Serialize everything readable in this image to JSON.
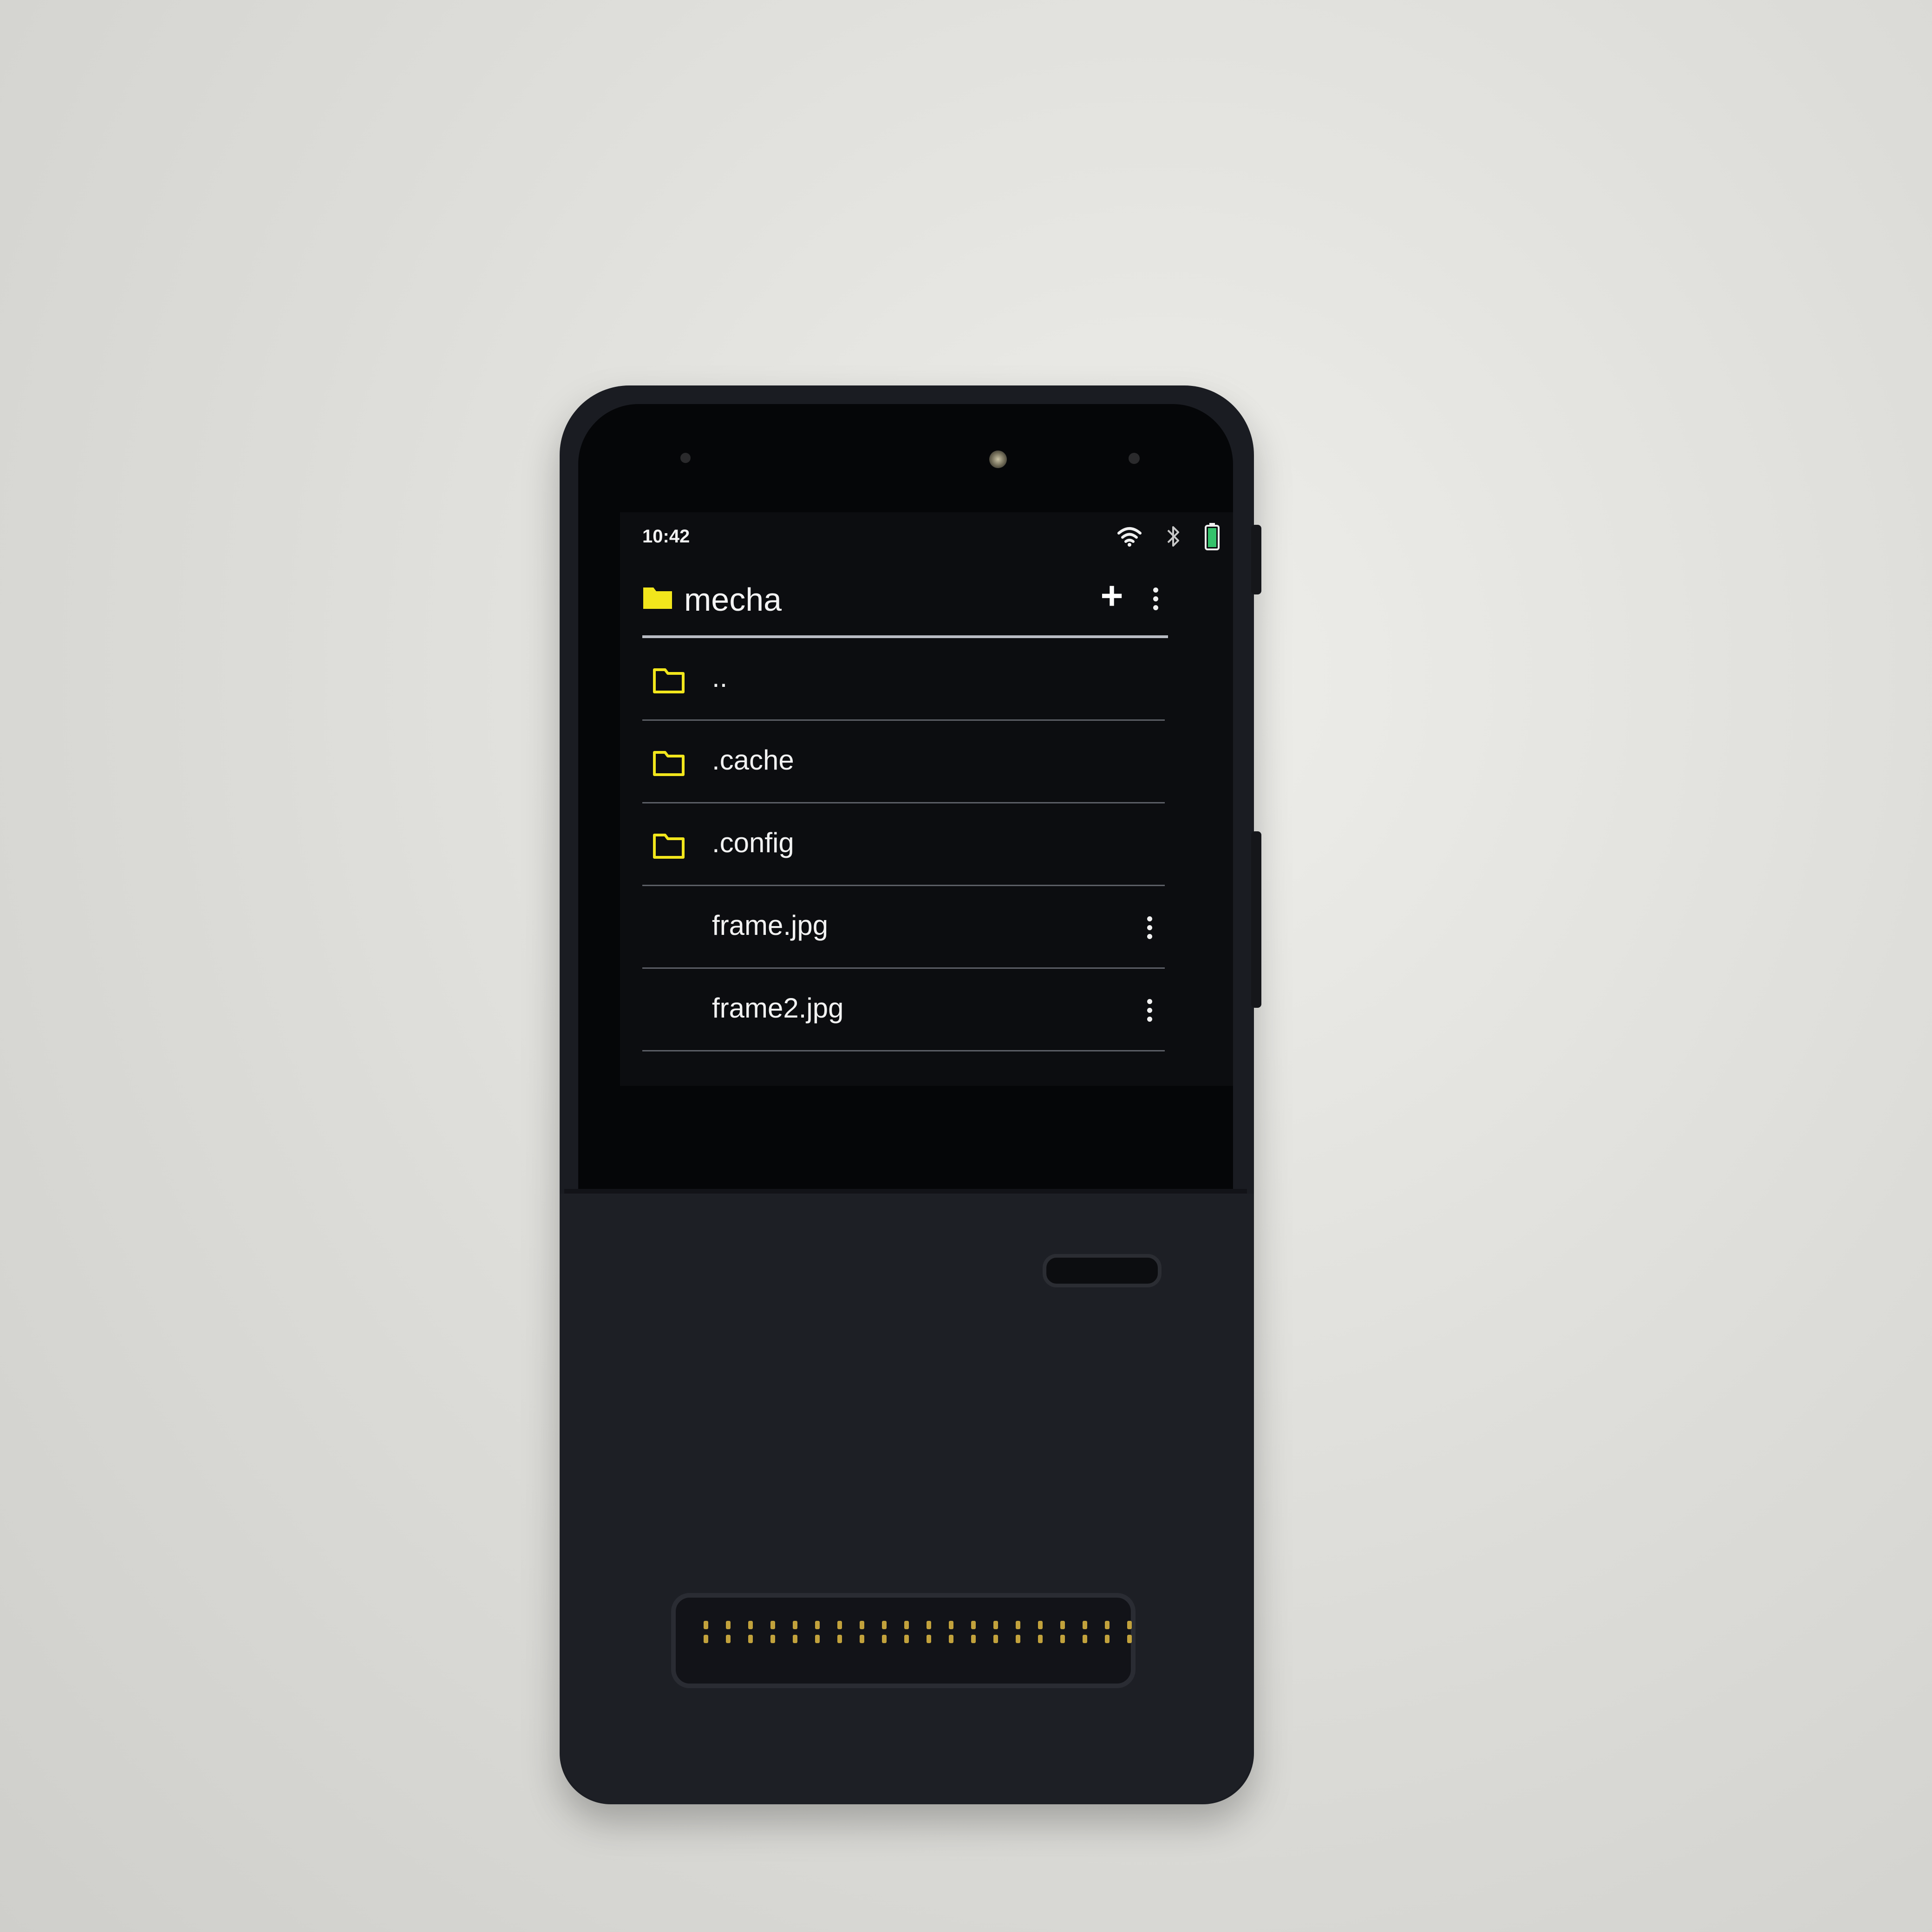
{
  "status_bar": {
    "time": "10:42",
    "icons": [
      "wifi-icon",
      "bluetooth-icon",
      "battery-icon"
    ]
  },
  "header": {
    "title": "mecha",
    "add_label": "+",
    "icon": "folder-icon"
  },
  "files": [
    {
      "name": "..",
      "type": "folder"
    },
    {
      "name": ".cache",
      "type": "folder"
    },
    {
      "name": ".config",
      "type": "folder"
    },
    {
      "name": "frame.jpg",
      "type": "file"
    },
    {
      "name": "frame2.jpg",
      "type": "file"
    }
  ],
  "colors": {
    "folder_accent": "#f2e61c",
    "screen_bg": "#0c0d10",
    "battery_green": "#35c26b"
  }
}
